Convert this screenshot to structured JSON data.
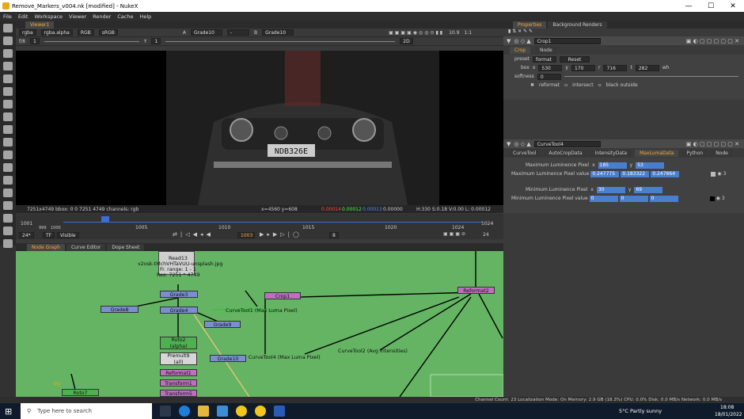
{
  "window": {
    "title": "Remove_Markers_v004.nk [modified] - NukeX",
    "minimize": "—",
    "maximize": "☐",
    "close": "✕"
  },
  "menu": [
    "File",
    "Edit",
    "Workspace",
    "Viewer",
    "Render",
    "Cache",
    "Help"
  ],
  "viewer": {
    "tab": "Viewer1",
    "channels": "rgba",
    "alpha": "rgba.alpha",
    "colorspace": "RGB",
    "lut": "sRGB",
    "input_a_label": "A",
    "input_a": "Grade10",
    "dash": "-",
    "input_b_label": "B",
    "input_b": "Grade10",
    "fstop_label": "f/8",
    "fstop_value": "1",
    "y_label": "Y",
    "y_value": "1",
    "zoom": "10.9",
    "frame_ratio": "1:1",
    "view_mode": "2D",
    "plate_text": "NDB326E",
    "info_left": "7251x4749  bbox: 0 0 7251 4749 channels: rgb",
    "info_coords": "x=4560 y=608",
    "info_r": "0.00014",
    "info_g": "0.00012",
    "info_b": "0.00013",
    "info_a": "0.00000",
    "info_hsv": "H:330 S:0.18 V:0.00  L: 0.00012"
  },
  "timeline": {
    "start": "1001",
    "end": "1024",
    "sub_start": "999",
    "sub_1000": "1000",
    "current": "1003",
    "ticks": [
      "1005",
      "1010",
      "1015",
      "1020",
      "1024"
    ],
    "fps": "24*",
    "tf": "TF",
    "visible": "Visible",
    "inc": "8",
    "frames_right": "24"
  },
  "nodegraph": {
    "tabs": [
      "Node Graph",
      "Curve Editor",
      "Dope Sheet"
    ],
    "read_node": {
      "name": "Read13",
      "file": "v2osk-tMchVHTaVUU-unsplash.jpg",
      "range": "Fr. range: 1 - 1",
      "res": "Res: 7251 * 4749"
    },
    "nodes": {
      "grade3": "Grade3",
      "grade8": "Grade8",
      "grade4": "Grade4",
      "grade9": "Grade9",
      "roto2": "Roto2",
      "roto2_sub": "(alpha)",
      "premult9": "Premult9",
      "premult9_sub": "(all)",
      "reformat1": "Reformat1",
      "transform1": "Transform1",
      "transform5": "Transform5",
      "grade10": "Grade10",
      "crop1": "Crop1",
      "reformat2": "Reformat2",
      "curvetool1": "CurveTool1 (Max Luma Pixel)",
      "curvetool4": "CurveTool4 (Max Luma Pixel)",
      "curvetool2": "CurveTool2 (Avg Intensities)",
      "roto_bottom": "Roto7",
      "bg_label": "bg"
    }
  },
  "properties": {
    "tabs": [
      "Properties",
      "Background Renders"
    ],
    "crop": {
      "name": "Crop1",
      "tabs": [
        "Crop",
        "Node"
      ],
      "preset_label": "preset",
      "preset_value": "format",
      "reset": "Reset",
      "box_label": "box",
      "box_x_label": "x",
      "box_x": "530",
      "box_y_label": "y",
      "box_y": "170",
      "box_r_label": "r",
      "box_r": "716",
      "box_t_label": "t",
      "box_t": "282",
      "wh": "wh",
      "softness_label": "softness",
      "softness_value": "0",
      "reformat": "reformat",
      "intersect": "intersect",
      "black_outside": "black outside"
    },
    "curvetool": {
      "name": "CurveTool4",
      "tabs": [
        "CurveTool",
        "AutoCropData",
        "IntensityData",
        "MaxLumaData",
        "Python",
        "Node"
      ],
      "max_pixel_label": "Maximum Luminence Pixel",
      "max_x_label": "x",
      "max_x": "185",
      "max_y_label": "y",
      "max_y": "53",
      "max_value_label": "Maximum Luminence Pixel value",
      "max_v1": "0.247775",
      "max_v2": "0.183322",
      "max_v3": "0.247664",
      "min_pixel_label": "Minimum Luminence Pixel",
      "min_x_label": "x",
      "min_x": "30",
      "min_y_label": "y",
      "min_y": "69",
      "min_value_label": "Minimum Luminence Pixel value",
      "min_v1": "0",
      "min_v2": "0",
      "min_v3": "0",
      "channel_count": "3"
    }
  },
  "status": "Channel Count: 23  Localization Mode: On  Memory: 2.9 GB (18.3%)  CPU: 0.0%  Disk: 0.0 MB/s  Network: 0.0 MB/s",
  "taskbar": {
    "search_placeholder": "Type here to search",
    "weather": "5°C  Partly sunny",
    "time": "18:08",
    "date": "18/01/2022"
  },
  "colors": {
    "nodegraph_bg": "#64b464",
    "grade_node": "#7a8fd0",
    "crop_node": "#c06ec0",
    "roto_node": "#4fb04f",
    "accent": "#f3a83c"
  }
}
